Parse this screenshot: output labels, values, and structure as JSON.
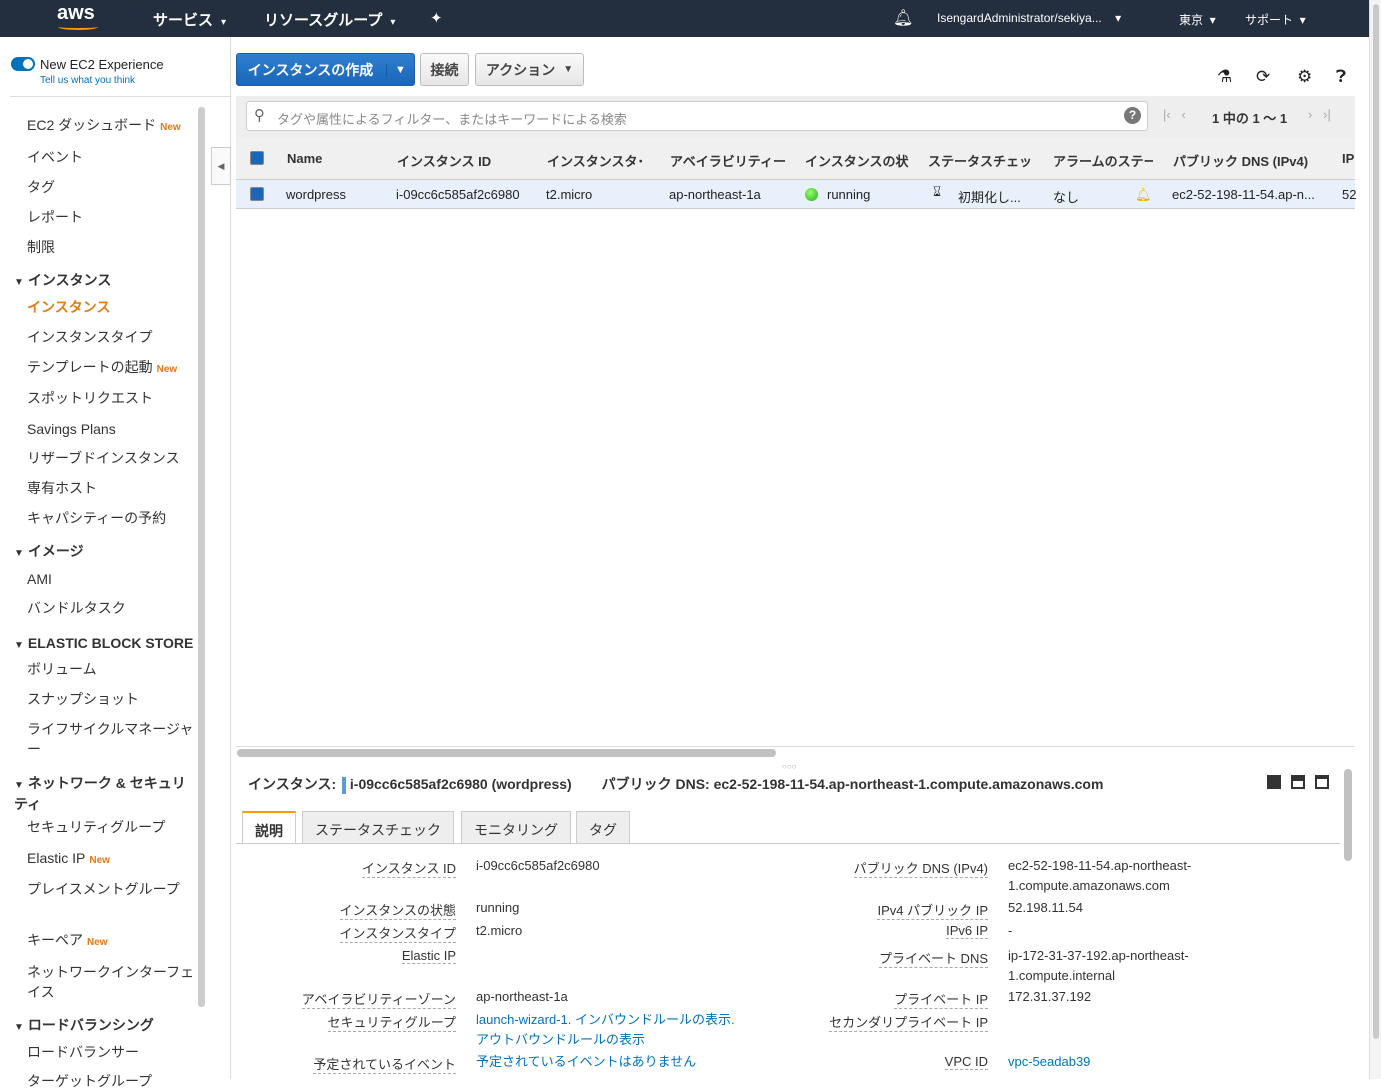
{
  "topbar": {
    "logo": "aws",
    "services": "サービス",
    "resource_groups": "リソースグループ",
    "user": "IsengardAdministrator/sekiya...",
    "region": "東京",
    "support": "サポート"
  },
  "sidebar": {
    "experience": "New EC2 Experience",
    "tell": "Tell us what you think",
    "new_badge": "New",
    "items": [
      {
        "label": "EC2 ダッシュボード",
        "new": true
      },
      {
        "label": "イベント"
      },
      {
        "label": "タグ"
      },
      {
        "label": "レポート"
      },
      {
        "label": "制限"
      }
    ],
    "sections": [
      {
        "title": "インスタンス",
        "items": [
          "インスタンス",
          "インスタンスタイプ",
          "テンプレートの起動",
          "スポットリクエスト",
          "Savings Plans",
          "リザーブドインスタンス",
          "専有ホスト",
          "キャパシティーの予約"
        ]
      },
      {
        "title": "イメージ",
        "items": [
          "AMI",
          "バンドルタスク"
        ]
      },
      {
        "title": "ELASTIC BLOCK STORE",
        "items": [
          "ボリューム",
          "スナップショット",
          "ライフサイクルマネージャー"
        ]
      },
      {
        "title": "ネットワーク & セキュリティ",
        "items": [
          "セキュリティグループ",
          "Elastic IP",
          "プレイスメントグループ",
          "キーペア",
          "ネットワークインターフェイス"
        ]
      },
      {
        "title": "ロードバランシング",
        "items": [
          "ロードバランサー",
          "ターゲットグループ"
        ]
      }
    ]
  },
  "toolbar": {
    "launch": "インスタンスの作成",
    "connect": "接続",
    "actions": "アクション"
  },
  "filter": {
    "placeholder": "タグや属性によるフィルター、またはキーワードによる検索",
    "pager": "1 中の 1 〜 1"
  },
  "table": {
    "columns": [
      "Name",
      "インスタンス ID",
      "インスタンスタ･",
      "アベイラビリティー",
      "インスタンスの状",
      "ステータスチェッ",
      "アラームのステー",
      "パブリック DNS (IPv4)",
      "IP"
    ],
    "rows": [
      {
        "name": "wordpress",
        "id": "i-09cc6c585af2c6980",
        "type": "t2.micro",
        "az": "ap-northeast-1a",
        "state": "running",
        "status": "初期化し...",
        "alarm": "なし",
        "dns": "ec2-52-198-11-54.ap-n...",
        "ip": "52"
      }
    ]
  },
  "detail": {
    "instance_label": "インスタンス:",
    "instance": "i-09cc6c585af2c6980 (wordpress)",
    "dns_label": "パブリック DNS:",
    "dns": "ec2-52-198-11-54.ap-northeast-1.compute.amazonaws.com",
    "tabs": [
      "説明",
      "ステータスチェック",
      "モニタリング",
      "タグ"
    ],
    "left": [
      {
        "k": "インスタンス ID",
        "v": "i-09cc6c585af2c6980"
      },
      {
        "k": "インスタンスの状態",
        "v": "running"
      },
      {
        "k": "インスタンスタイプ",
        "v": "t2.micro"
      },
      {
        "k": "Elastic IP",
        "v": ""
      },
      {
        "k": "アベイラビリティーゾーン",
        "v": "ap-northeast-1a"
      },
      {
        "k": "セキュリティグループ",
        "v": "launch-wizard-1. インバウンドルールの表示.",
        "v2": "アウトバウンドルールの表示"
      },
      {
        "k": "予定されているイベント",
        "v": "予定されているイベントはありません"
      }
    ],
    "right": [
      {
        "k": "パブリック DNS (IPv4)",
        "v": "ec2-52-198-11-54.ap-northeast-",
        "v2": "1.compute.amazonaws.com"
      },
      {
        "k": "IPv4 パブリック IP",
        "v": "52.198.11.54"
      },
      {
        "k": "IPv6 IP",
        "v": "-"
      },
      {
        "k": "プライベート DNS",
        "v": "ip-172-31-37-192.ap-northeast-",
        "v2": "1.compute.internal"
      },
      {
        "k": "プライベート IP",
        "v": "172.31.37.192"
      },
      {
        "k": "セカンダリプライベート IP",
        "v": ""
      },
      {
        "k": "VPC ID",
        "v": "vpc-5eadab39"
      }
    ]
  }
}
